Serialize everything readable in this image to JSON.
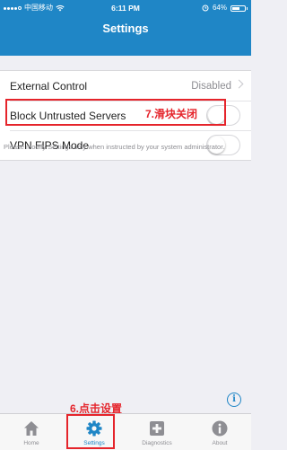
{
  "status_bar": {
    "carrier": "中国移动",
    "time": "6:11 PM",
    "battery": "64%",
    "battery_level": 0.64
  },
  "header": {
    "title": "Settings"
  },
  "settings": [
    {
      "label": "External Control",
      "value": "Disabled",
      "kind": "link"
    },
    {
      "label": "Block Untrusted Servers",
      "kind": "toggle",
      "on": false
    },
    {
      "label": "VPN FIPS Mode",
      "kind": "toggle",
      "on": false
    }
  ],
  "note": "Please modify Settings only when instructed by your system administrator.",
  "annotations": {
    "step7": "7.滑块关闭",
    "step6": "6.点击设置"
  },
  "info_icon": "i",
  "tabs": [
    {
      "label": "Home",
      "icon": "home-icon",
      "active": false
    },
    {
      "label": "Settings",
      "icon": "gear-icon",
      "active": true
    },
    {
      "label": "Diagnostics",
      "icon": "plus-icon",
      "active": false
    },
    {
      "label": "About",
      "icon": "info-icon",
      "active": false
    }
  ],
  "colors": {
    "accent": "#1f86c6",
    "annotation": "#e5242b",
    "inactive": "#8e8e93"
  }
}
